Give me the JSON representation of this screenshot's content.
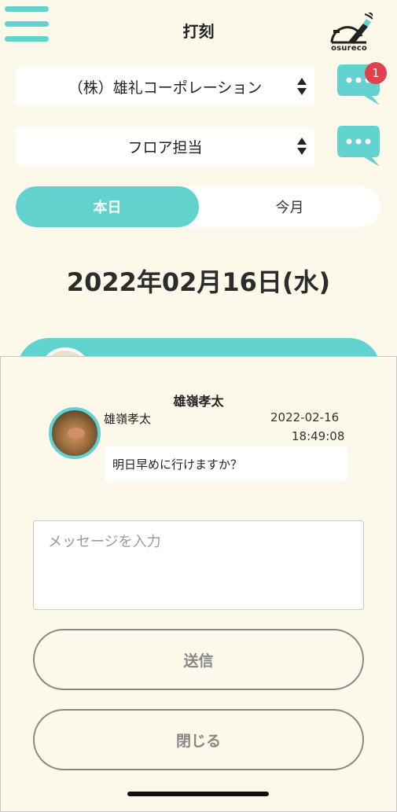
{
  "header": {
    "title": "打刻",
    "logo_text": "osureco",
    "menu_icon": "hamburger-icon"
  },
  "selects": {
    "company": "（株）雄礼コーポレーション",
    "role": "フロア担当"
  },
  "notifications": {
    "badge_count": "1",
    "icon": "chat-bubble-icon"
  },
  "tabs": [
    {
      "label": "本日",
      "selected": true
    },
    {
      "label": "今月",
      "selected": false
    }
  ],
  "date_label": "2022年02月16日(水)",
  "modal": {
    "title": "雄嶺孝太",
    "message": {
      "sender": "雄嶺孝太",
      "date": "2022-02-16",
      "time": "18:49:08",
      "text": "明日早めに行けますか？"
    },
    "input_placeholder": "メッセージを入力",
    "send_label": "送信",
    "close_label": "閉じる"
  },
  "colors": {
    "accent": "#62d2cf",
    "background": "#fcf8ea",
    "badge": "#e0414e"
  }
}
